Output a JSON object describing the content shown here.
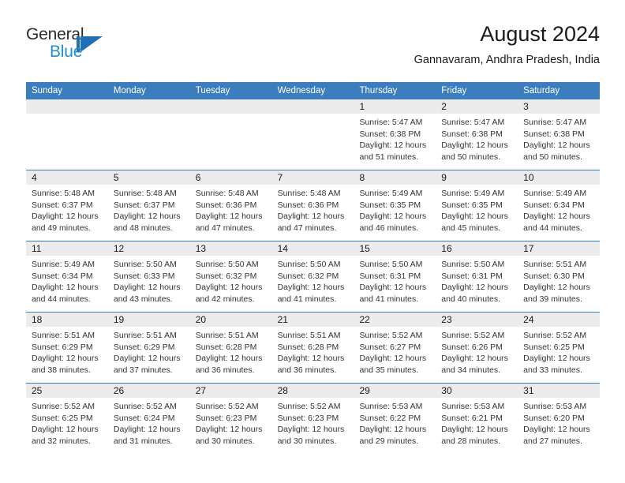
{
  "brand": {
    "name_part1": "General",
    "name_part2": "Blue",
    "logo_icon": "general-blue-triangle-logo",
    "accent_color": "#1f6fb5",
    "secondary_color": "#1f8fd8"
  },
  "header": {
    "title": "August 2024",
    "subtitle": "Gannavaram, Andhra Pradesh, India"
  },
  "theme": {
    "header_band": "#3b7dbd",
    "day_band": "#ececec",
    "text": "#333333"
  },
  "weekdays": [
    "Sunday",
    "Monday",
    "Tuesday",
    "Wednesday",
    "Thursday",
    "Friday",
    "Saturday"
  ],
  "weeks": [
    [
      {
        "day": "",
        "empty": true,
        "lines": []
      },
      {
        "day": "",
        "empty": true,
        "lines": []
      },
      {
        "day": "",
        "empty": true,
        "lines": []
      },
      {
        "day": "",
        "empty": true,
        "lines": []
      },
      {
        "day": "1",
        "empty": false,
        "lines": [
          "Sunrise: 5:47 AM",
          "Sunset: 6:38 PM",
          "Daylight: 12 hours",
          "and 51 minutes."
        ]
      },
      {
        "day": "2",
        "empty": false,
        "lines": [
          "Sunrise: 5:47 AM",
          "Sunset: 6:38 PM",
          "Daylight: 12 hours",
          "and 50 minutes."
        ]
      },
      {
        "day": "3",
        "empty": false,
        "lines": [
          "Sunrise: 5:47 AM",
          "Sunset: 6:38 PM",
          "Daylight: 12 hours",
          "and 50 minutes."
        ]
      }
    ],
    [
      {
        "day": "4",
        "empty": false,
        "lines": [
          "Sunrise: 5:48 AM",
          "Sunset: 6:37 PM",
          "Daylight: 12 hours",
          "and 49 minutes."
        ]
      },
      {
        "day": "5",
        "empty": false,
        "lines": [
          "Sunrise: 5:48 AM",
          "Sunset: 6:37 PM",
          "Daylight: 12 hours",
          "and 48 minutes."
        ]
      },
      {
        "day": "6",
        "empty": false,
        "lines": [
          "Sunrise: 5:48 AM",
          "Sunset: 6:36 PM",
          "Daylight: 12 hours",
          "and 47 minutes."
        ]
      },
      {
        "day": "7",
        "empty": false,
        "lines": [
          "Sunrise: 5:48 AM",
          "Sunset: 6:36 PM",
          "Daylight: 12 hours",
          "and 47 minutes."
        ]
      },
      {
        "day": "8",
        "empty": false,
        "lines": [
          "Sunrise: 5:49 AM",
          "Sunset: 6:35 PM",
          "Daylight: 12 hours",
          "and 46 minutes."
        ]
      },
      {
        "day": "9",
        "empty": false,
        "lines": [
          "Sunrise: 5:49 AM",
          "Sunset: 6:35 PM",
          "Daylight: 12 hours",
          "and 45 minutes."
        ]
      },
      {
        "day": "10",
        "empty": false,
        "lines": [
          "Sunrise: 5:49 AM",
          "Sunset: 6:34 PM",
          "Daylight: 12 hours",
          "and 44 minutes."
        ]
      }
    ],
    [
      {
        "day": "11",
        "empty": false,
        "lines": [
          "Sunrise: 5:49 AM",
          "Sunset: 6:34 PM",
          "Daylight: 12 hours",
          "and 44 minutes."
        ]
      },
      {
        "day": "12",
        "empty": false,
        "lines": [
          "Sunrise: 5:50 AM",
          "Sunset: 6:33 PM",
          "Daylight: 12 hours",
          "and 43 minutes."
        ]
      },
      {
        "day": "13",
        "empty": false,
        "lines": [
          "Sunrise: 5:50 AM",
          "Sunset: 6:32 PM",
          "Daylight: 12 hours",
          "and 42 minutes."
        ]
      },
      {
        "day": "14",
        "empty": false,
        "lines": [
          "Sunrise: 5:50 AM",
          "Sunset: 6:32 PM",
          "Daylight: 12 hours",
          "and 41 minutes."
        ]
      },
      {
        "day": "15",
        "empty": false,
        "lines": [
          "Sunrise: 5:50 AM",
          "Sunset: 6:31 PM",
          "Daylight: 12 hours",
          "and 41 minutes."
        ]
      },
      {
        "day": "16",
        "empty": false,
        "lines": [
          "Sunrise: 5:50 AM",
          "Sunset: 6:31 PM",
          "Daylight: 12 hours",
          "and 40 minutes."
        ]
      },
      {
        "day": "17",
        "empty": false,
        "lines": [
          "Sunrise: 5:51 AM",
          "Sunset: 6:30 PM",
          "Daylight: 12 hours",
          "and 39 minutes."
        ]
      }
    ],
    [
      {
        "day": "18",
        "empty": false,
        "lines": [
          "Sunrise: 5:51 AM",
          "Sunset: 6:29 PM",
          "Daylight: 12 hours",
          "and 38 minutes."
        ]
      },
      {
        "day": "19",
        "empty": false,
        "lines": [
          "Sunrise: 5:51 AM",
          "Sunset: 6:29 PM",
          "Daylight: 12 hours",
          "and 37 minutes."
        ]
      },
      {
        "day": "20",
        "empty": false,
        "lines": [
          "Sunrise: 5:51 AM",
          "Sunset: 6:28 PM",
          "Daylight: 12 hours",
          "and 36 minutes."
        ]
      },
      {
        "day": "21",
        "empty": false,
        "lines": [
          "Sunrise: 5:51 AM",
          "Sunset: 6:28 PM",
          "Daylight: 12 hours",
          "and 36 minutes."
        ]
      },
      {
        "day": "22",
        "empty": false,
        "lines": [
          "Sunrise: 5:52 AM",
          "Sunset: 6:27 PM",
          "Daylight: 12 hours",
          "and 35 minutes."
        ]
      },
      {
        "day": "23",
        "empty": false,
        "lines": [
          "Sunrise: 5:52 AM",
          "Sunset: 6:26 PM",
          "Daylight: 12 hours",
          "and 34 minutes."
        ]
      },
      {
        "day": "24",
        "empty": false,
        "lines": [
          "Sunrise: 5:52 AM",
          "Sunset: 6:25 PM",
          "Daylight: 12 hours",
          "and 33 minutes."
        ]
      }
    ],
    [
      {
        "day": "25",
        "empty": false,
        "lines": [
          "Sunrise: 5:52 AM",
          "Sunset: 6:25 PM",
          "Daylight: 12 hours",
          "and 32 minutes."
        ]
      },
      {
        "day": "26",
        "empty": false,
        "lines": [
          "Sunrise: 5:52 AM",
          "Sunset: 6:24 PM",
          "Daylight: 12 hours",
          "and 31 minutes."
        ]
      },
      {
        "day": "27",
        "empty": false,
        "lines": [
          "Sunrise: 5:52 AM",
          "Sunset: 6:23 PM",
          "Daylight: 12 hours",
          "and 30 minutes."
        ]
      },
      {
        "day": "28",
        "empty": false,
        "lines": [
          "Sunrise: 5:52 AM",
          "Sunset: 6:23 PM",
          "Daylight: 12 hours",
          "and 30 minutes."
        ]
      },
      {
        "day": "29",
        "empty": false,
        "lines": [
          "Sunrise: 5:53 AM",
          "Sunset: 6:22 PM",
          "Daylight: 12 hours",
          "and 29 minutes."
        ]
      },
      {
        "day": "30",
        "empty": false,
        "lines": [
          "Sunrise: 5:53 AM",
          "Sunset: 6:21 PM",
          "Daylight: 12 hours",
          "and 28 minutes."
        ]
      },
      {
        "day": "31",
        "empty": false,
        "lines": [
          "Sunrise: 5:53 AM",
          "Sunset: 6:20 PM",
          "Daylight: 12 hours",
          "and 27 minutes."
        ]
      }
    ]
  ]
}
